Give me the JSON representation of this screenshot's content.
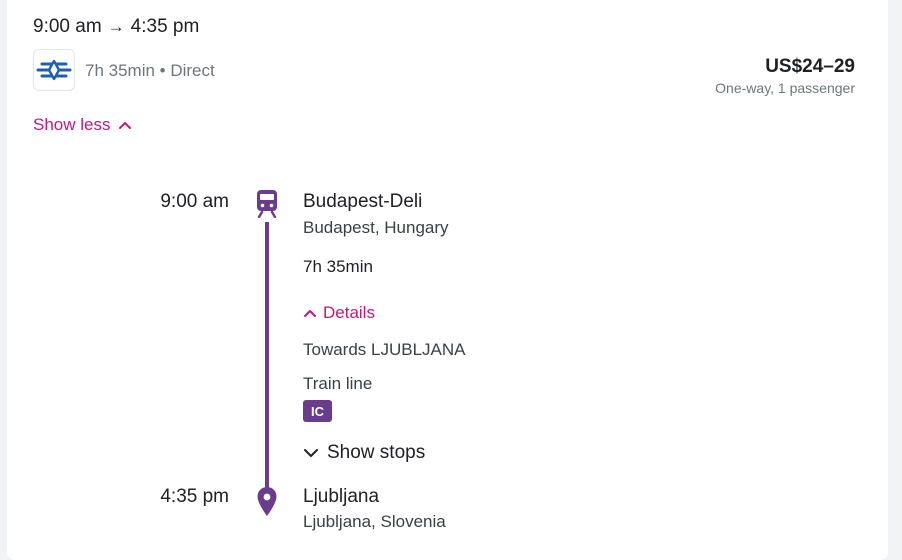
{
  "header": {
    "depart": "9:00 am",
    "arrow": "→",
    "arrive": "4:35 pm",
    "operator_logo_icon": "mav-logo-icon",
    "summary": "7h 35min • Direct",
    "price": "US$24–29",
    "price_note": "One-way, 1 passenger",
    "show_less_label": "Show less"
  },
  "route": {
    "origin": {
      "time": "9:00 am",
      "station": "Budapest-Deli",
      "location": "Budapest, Hungary",
      "icon": "train-icon"
    },
    "duration": "7h 35min",
    "details_label": "Details",
    "towards": "Towards LJUBLJANA",
    "train_line_label": "Train line",
    "train_line_badge": "IC",
    "show_stops_label": "Show stops",
    "destination": {
      "time": "4:35 pm",
      "station": "Ljubljana",
      "location": "Ljubljana, Slovenia",
      "icon": "map-pin-icon"
    }
  },
  "colors": {
    "accent": "#c2187a",
    "route_line": "#6a3d8c",
    "logo_blue": "#1f5fb0"
  }
}
